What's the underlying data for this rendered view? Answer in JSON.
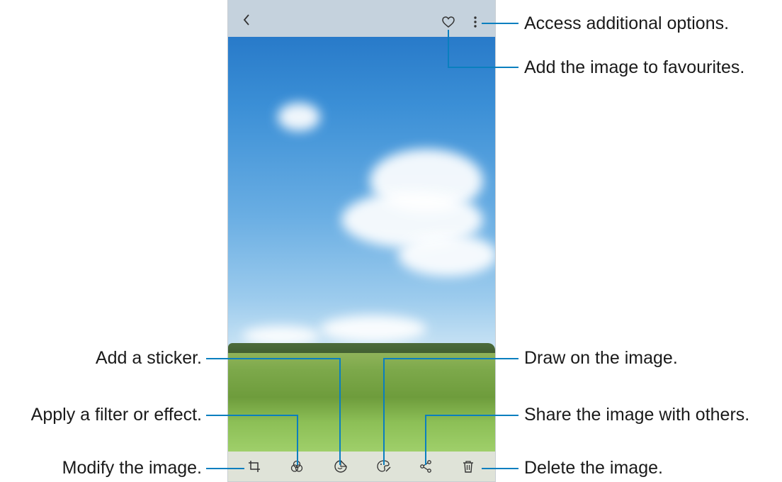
{
  "annotations": {
    "more_options": "Access additional options.",
    "favourite": "Add the image to favourites.",
    "sticker": "Add a sticker.",
    "filter": "Apply a filter or effect.",
    "modify": "Modify the image.",
    "draw": "Draw on the image.",
    "share": "Share the image with others.",
    "delete": "Delete the image."
  },
  "icons": {
    "back": "back-arrow-icon",
    "favourite": "heart-icon",
    "more": "more-options-icon",
    "modify": "crop-rotate-icon",
    "filter": "filter-circles-icon",
    "sticker": "sticker-icon",
    "draw": "paint-palette-icon",
    "share": "share-icon",
    "delete": "trash-icon"
  },
  "colors": {
    "callout_line": "#0a7fbf"
  }
}
